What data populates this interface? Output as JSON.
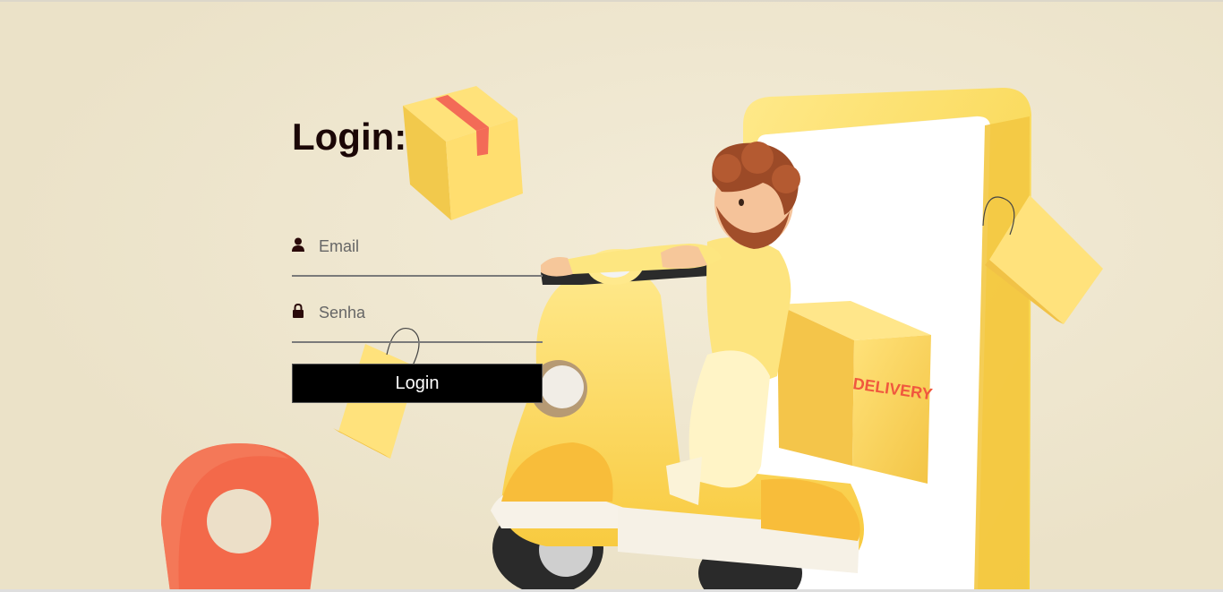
{
  "login": {
    "title": "Login:",
    "email_placeholder": "Email",
    "password_placeholder": "Senha",
    "button_label": "Login"
  },
  "illustration": {
    "box_label": "DELIVERY"
  },
  "icons": {
    "email": "user-icon",
    "password": "lock-icon"
  },
  "colors": {
    "background": "#efe7d0",
    "button": "#000000",
    "title": "#1b0606",
    "accent_yellow": "#f7d84a",
    "pin_red": "#f3694a"
  }
}
